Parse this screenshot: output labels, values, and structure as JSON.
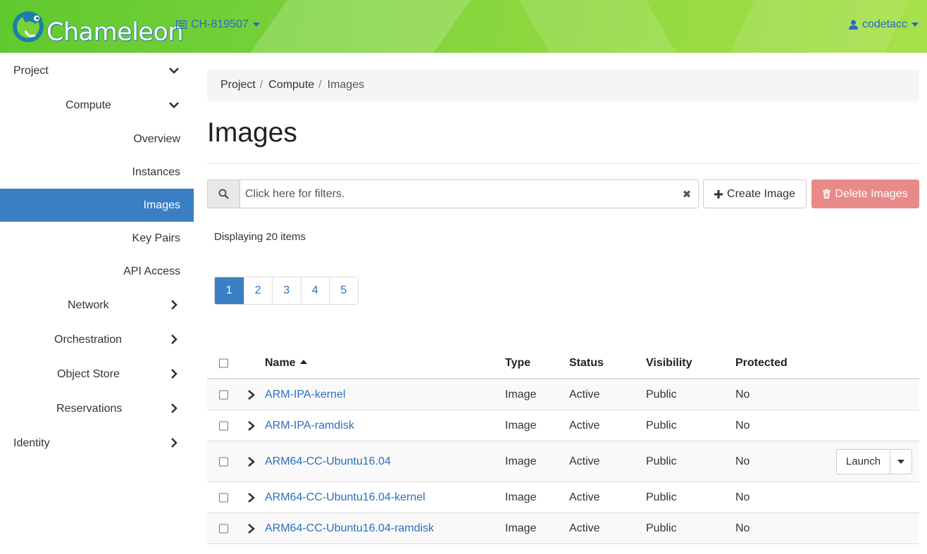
{
  "header": {
    "logo_text": "Chameleon",
    "project": "CH-819507",
    "user": "codetacc"
  },
  "sidebar": {
    "items": [
      {
        "label": "Project"
      },
      {
        "label": "Compute"
      },
      {
        "label": "Overview"
      },
      {
        "label": "Instances"
      },
      {
        "label": "Images"
      },
      {
        "label": "Key Pairs"
      },
      {
        "label": "API Access"
      },
      {
        "label": "Network"
      },
      {
        "label": "Orchestration"
      },
      {
        "label": "Object Store"
      },
      {
        "label": "Reservations"
      },
      {
        "label": "Identity"
      }
    ]
  },
  "breadcrumb": {
    "items": [
      "Project",
      "Compute",
      "Images"
    ],
    "separator": "/"
  },
  "page": {
    "title": "Images"
  },
  "filter": {
    "placeholder": "Click here for filters.",
    "clear_glyph": "✖"
  },
  "actions": {
    "create_label": "Create Image",
    "delete_label": "Delete Images"
  },
  "table_info": {
    "count_text": "Displaying 20 items"
  },
  "pagination": {
    "pages": [
      "1",
      "2",
      "3",
      "4",
      "5"
    ],
    "current": "1"
  },
  "table": {
    "columns": {
      "name": "Name",
      "type": "Type",
      "status": "Status",
      "visibility": "Visibility",
      "protected": "Protected"
    },
    "rows": [
      {
        "name": "ARM-IPA-kernel",
        "type": "Image",
        "status": "Active",
        "visibility": "Public",
        "protected": "No"
      },
      {
        "name": "ARM-IPA-ramdisk",
        "type": "Image",
        "status": "Active",
        "visibility": "Public",
        "protected": "No"
      },
      {
        "name": "ARM64-CC-Ubuntu16.04",
        "type": "Image",
        "status": "Active",
        "visibility": "Public",
        "protected": "No",
        "action": "Launch"
      },
      {
        "name": "ARM64-CC-Ubuntu16.04-kernel",
        "type": "Image",
        "status": "Active",
        "visibility": "Public",
        "protected": "No"
      },
      {
        "name": "ARM64-CC-Ubuntu16.04-ramdisk",
        "type": "Image",
        "status": "Active",
        "visibility": "Public",
        "protected": "No"
      }
    ]
  },
  "colors": {
    "accent": "#3a7fc3",
    "link": "#2a6fc0",
    "danger": "#e88b88",
    "header_green": "#7ad23a"
  },
  "icons": [
    "chameleon-logo-icon",
    "project-icon",
    "user-icon",
    "chevron-down-icon",
    "chevron-right-icon",
    "search-icon",
    "clear-icon",
    "plus-icon",
    "trash-icon",
    "sort-ascending-icon"
  ]
}
